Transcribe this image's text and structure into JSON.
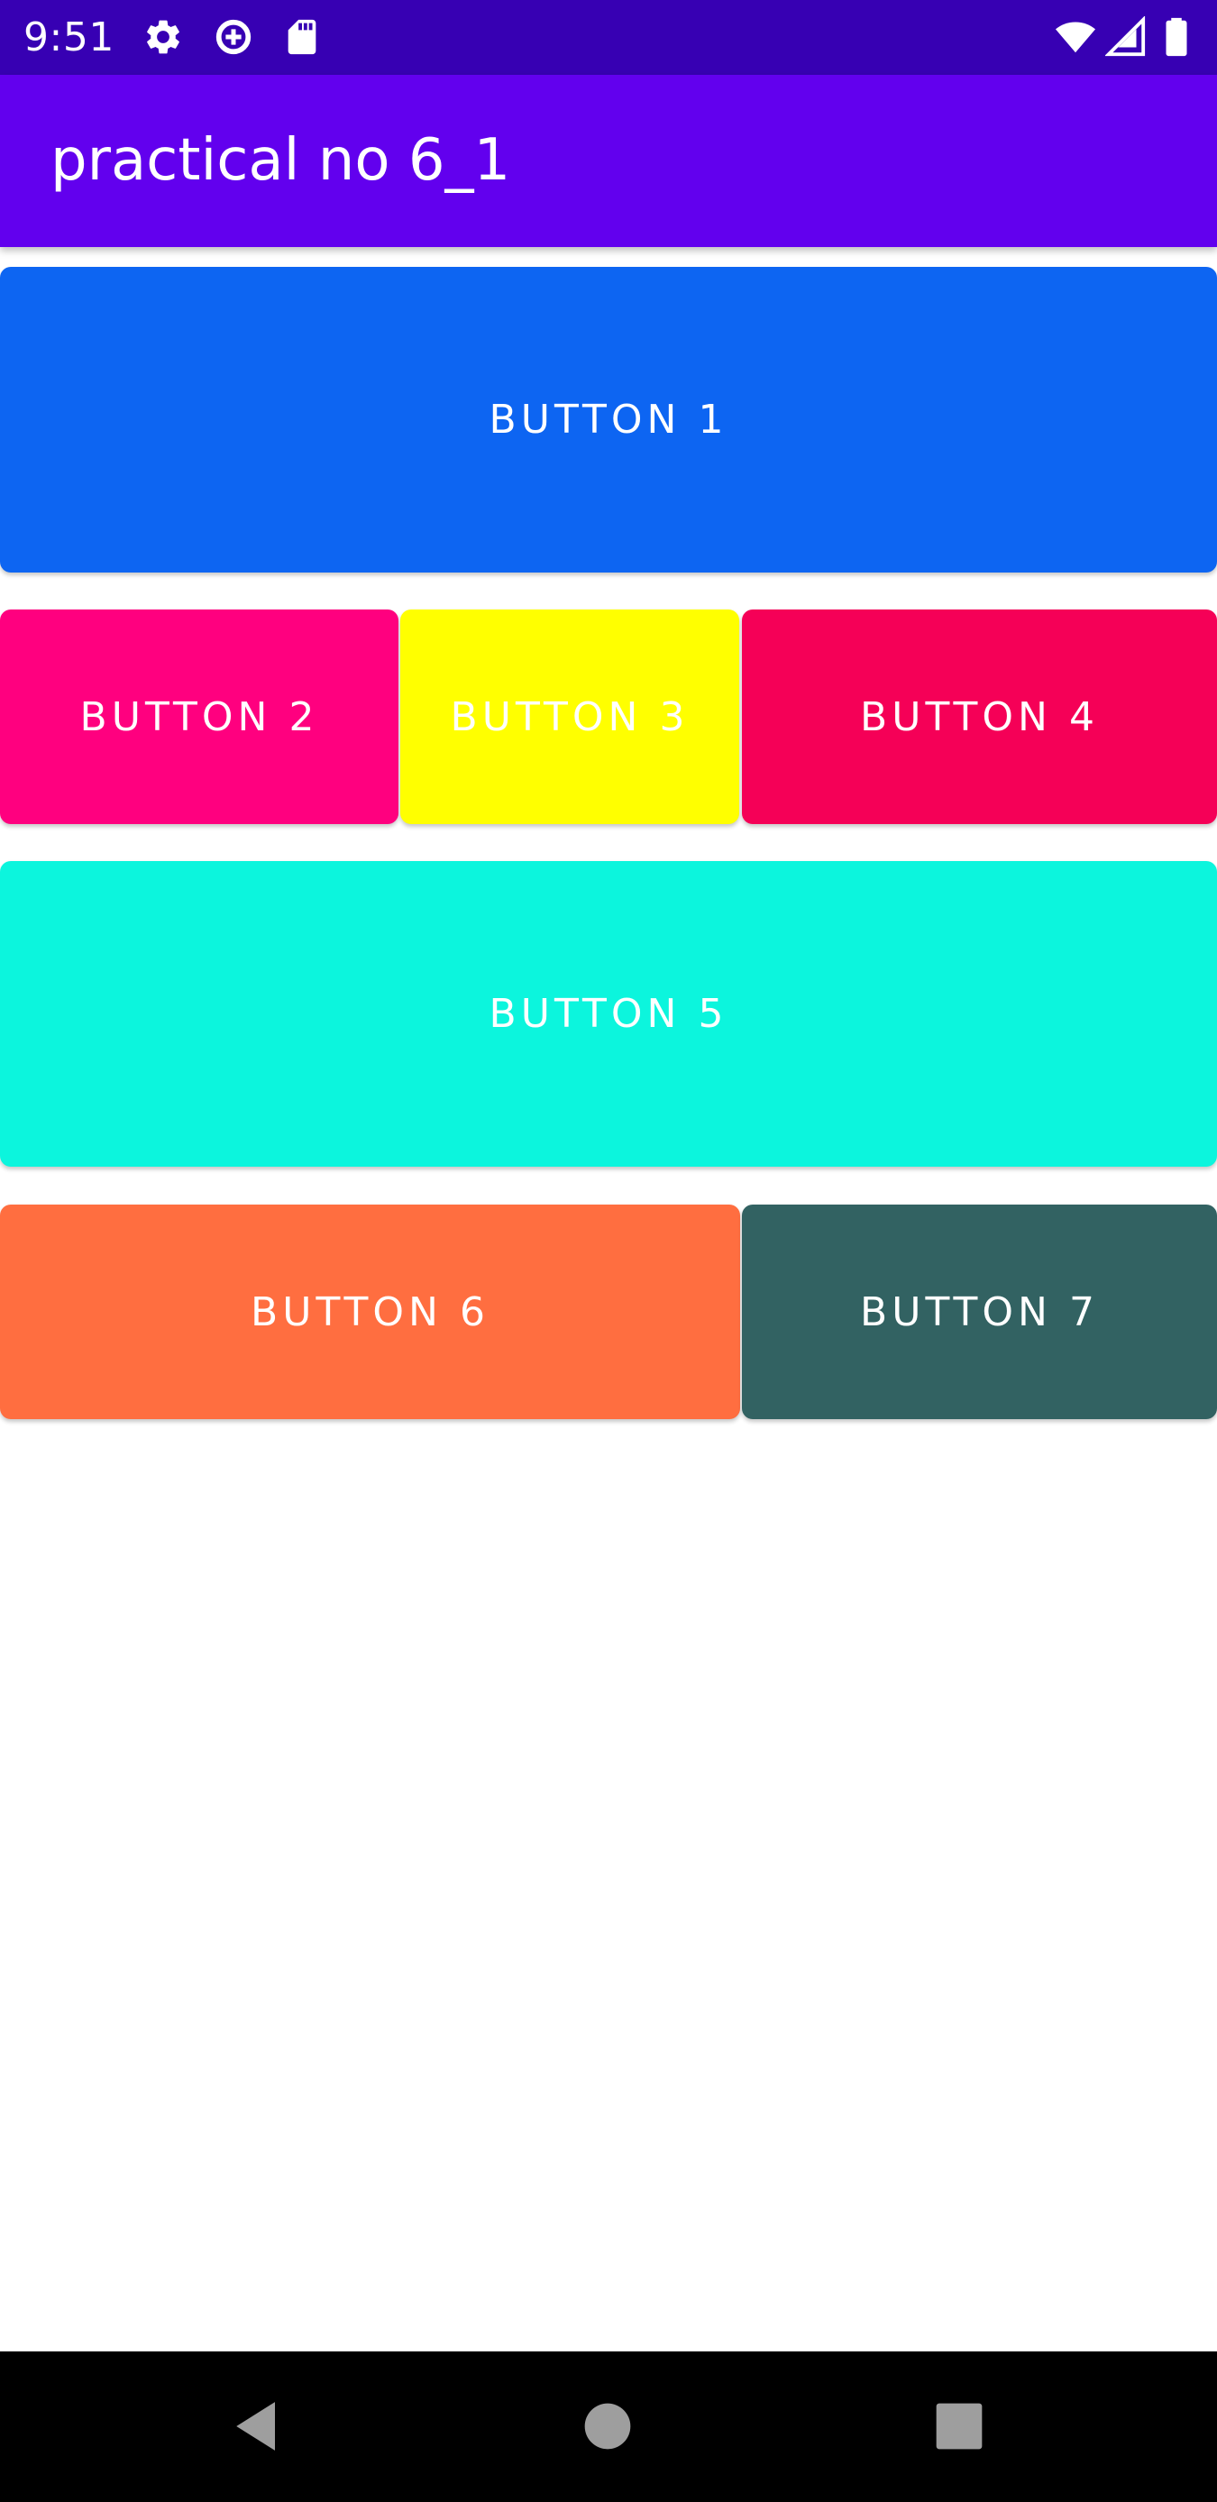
{
  "status_bar": {
    "time": "9:51",
    "icons_left": [
      "gear-icon",
      "data-saver-icon",
      "sd-card-icon"
    ],
    "icons_right": [
      "wifi-icon",
      "cell-signal-icon",
      "battery-icon"
    ],
    "background": "#3700b3"
  },
  "app_bar": {
    "title": "practical no 6_1",
    "background": "#6200ee"
  },
  "buttons": [
    {
      "label": "BUTTON 1",
      "color": "#0d65f2"
    },
    {
      "label": "BUTTON 2",
      "color": "#ff007f"
    },
    {
      "label": "BUTTON 3",
      "color": "#ffff00"
    },
    {
      "label": "BUTTON 4",
      "color": "#f50057"
    },
    {
      "label": "BUTTON 5",
      "color": "#0cf5dd"
    },
    {
      "label": "BUTTON 6",
      "color": "#ff6e40"
    },
    {
      "label": "BUTTON 7",
      "color": "#326262"
    }
  ],
  "nav_bar": {
    "icons": [
      "back-icon",
      "home-icon",
      "recents-icon"
    ],
    "background": "#000000"
  }
}
